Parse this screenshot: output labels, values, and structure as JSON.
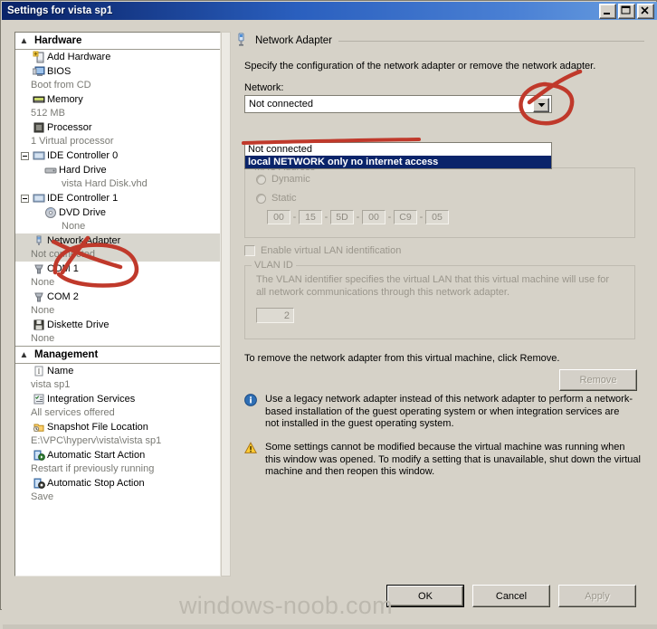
{
  "window": {
    "title": "Settings for vista sp1",
    "buttons": {
      "minimize": "minimize",
      "maximize": "maximize",
      "close": "close"
    }
  },
  "sidebar": {
    "sections": [
      {
        "label": "Hardware",
        "items": [
          {
            "label": "Add Hardware",
            "sub": "",
            "icon": "add-hardware-icon",
            "indent": 0,
            "expander": false
          },
          {
            "label": "BIOS",
            "sub": "Boot from CD",
            "icon": "bios-icon",
            "indent": 0,
            "expander": false
          },
          {
            "label": "Memory",
            "sub": "512 MB",
            "icon": "memory-icon",
            "indent": 0,
            "expander": false
          },
          {
            "label": "Processor",
            "sub": "1 Virtual processor",
            "icon": "processor-icon",
            "indent": 0,
            "expander": false
          },
          {
            "label": "IDE Controller 0",
            "sub": "",
            "icon": "ide-controller-icon",
            "indent": 0,
            "expander": true
          },
          {
            "label": "Hard Drive",
            "sub": "vista Hard Disk.vhd",
            "icon": "hard-drive-icon",
            "indent": 1,
            "expander": false
          },
          {
            "label": "IDE Controller 1",
            "sub": "",
            "icon": "ide-controller-icon",
            "indent": 0,
            "expander": true
          },
          {
            "label": "DVD Drive",
            "sub": "None",
            "icon": "dvd-drive-icon",
            "indent": 1,
            "expander": false
          },
          {
            "label": "Network Adapter",
            "sub": "Not connected",
            "icon": "network-adapter-icon",
            "indent": 0,
            "expander": false,
            "selected": true
          },
          {
            "label": "COM 1",
            "sub": "None",
            "icon": "com-port-icon",
            "indent": 0,
            "expander": false
          },
          {
            "label": "COM 2",
            "sub": "None",
            "icon": "com-port-icon",
            "indent": 0,
            "expander": false
          },
          {
            "label": "Diskette Drive",
            "sub": "None",
            "icon": "diskette-drive-icon",
            "indent": 0,
            "expander": false
          }
        ]
      },
      {
        "label": "Management",
        "items": [
          {
            "label": "Name",
            "sub": "vista sp1",
            "icon": "name-icon",
            "indent": 0,
            "expander": false
          },
          {
            "label": "Integration Services",
            "sub": "All services offered",
            "icon": "integration-services-icon",
            "indent": 0,
            "expander": false
          },
          {
            "label": "Snapshot File Location",
            "sub": "E:\\VPC\\hyperv\\vista\\vista sp1",
            "icon": "snapshot-folder-icon",
            "indent": 0,
            "expander": false
          },
          {
            "label": "Automatic Start Action",
            "sub": "Restart if previously running",
            "icon": "start-action-icon",
            "indent": 0,
            "expander": false
          },
          {
            "label": "Automatic Stop Action",
            "sub": "Save",
            "icon": "stop-action-icon",
            "indent": 0,
            "expander": false
          }
        ]
      }
    ]
  },
  "main": {
    "panel_title": "Network Adapter",
    "description": "Specify the configuration of the network adapter or remove the network adapter.",
    "network_label": "Network:",
    "network_value": "Not connected",
    "network_options": [
      {
        "label": "Not connected",
        "highlighted": false
      },
      {
        "label": "local NETWORK only no internet access",
        "highlighted": true
      }
    ],
    "mac_group_label": "MAC Address",
    "mac_dynamic_label": "Dynamic",
    "mac_static_label": "Static",
    "mac_octets": [
      "00",
      "15",
      "5D",
      "00",
      "C9",
      "05"
    ],
    "mac_separator": "-",
    "vlan_checkbox_label": "Enable virtual LAN identification",
    "vlan_group_label": "VLAN ID",
    "vlan_description": "The VLAN identifier specifies the virtual LAN that this virtual machine will use for all network communications through this network adapter.",
    "vlan_value": "2",
    "remove_note": "To remove the network adapter from this virtual machine, click Remove.",
    "remove_button": "Remove",
    "notes": [
      {
        "icon": "info-icon",
        "text": "Use a legacy network adapter instead of this network adapter to perform a network-based installation of the guest operating system or when integration services are not installed in the guest operating system."
      },
      {
        "icon": "warning-icon",
        "text": "Some settings cannot be modified because the virtual machine was running when this window was opened. To modify a setting that is unavailable, shut down the virtual machine and then reopen this window."
      }
    ]
  },
  "footer": {
    "ok": "OK",
    "cancel": "Cancel",
    "apply": "Apply",
    "watermark": "windows-noob.com"
  },
  "colors": {
    "title_bar": "#0a246a",
    "highlight": "#0a246a",
    "annotation": "#c0392b",
    "disabled_text": "#9a968c"
  }
}
